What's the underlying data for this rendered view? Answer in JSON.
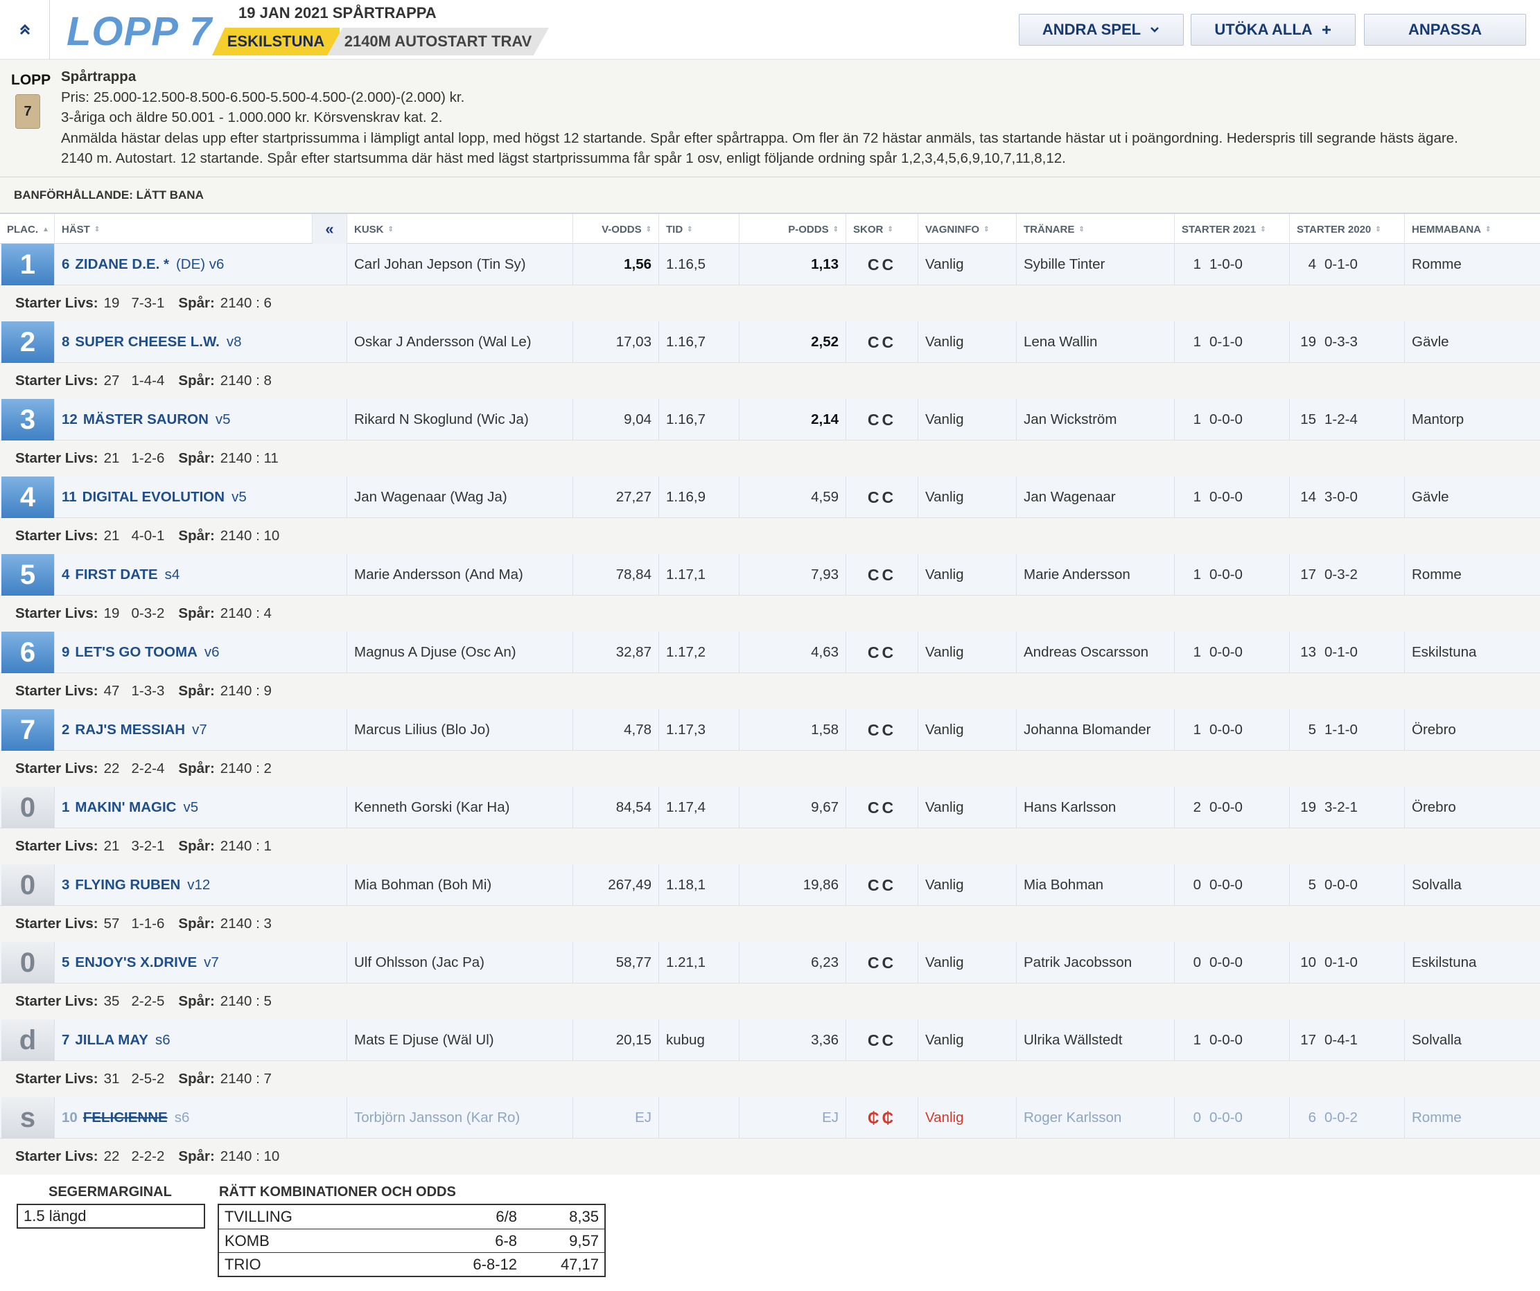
{
  "header": {
    "race_title": "LOPP 7",
    "date_line": "19 JAN 2021 SPÅRTRAPPA",
    "track": "ESKILSTUNA",
    "distance": "2140M AUTOSTART TRAV",
    "collapse_icon": "double-chevron-up",
    "buttons": {
      "andra_spel": "ANDRA SPEL",
      "andra_spel_icon": "chevron-down",
      "utoka_alla": "UTÖKA ALLA",
      "utoka_alla_icon": "plus",
      "anpassa": "ANPASSA"
    }
  },
  "info": {
    "lopp_label": "LOPP",
    "lopp_number": "7",
    "lines": [
      "Spårtrappa",
      "Pris: 25.000-12.500-8.500-6.500-5.500-4.500-(2.000)-(2.000) kr.",
      "3-åriga och äldre 50.001 - 1.000.000 kr. Körsvenskrav kat. 2.",
      "Anmälda hästar delas upp efter startprissumma i lämpligt antal lopp, med högst 12 startande. Spår efter spårtrappa. Om fler än 72 hästar anmäls, tas startande hästar ut i poängordning. Hederspris till segrande hästs ägare.",
      "2140 m. Autostart. 12 startande. Spår efter startsumma där häst med lägst startprissumma får spår 1 osv, enligt följande ordning spår 1,2,3,4,5,6,9,10,7,11,8,12."
    ]
  },
  "condition": "BANFÖRHÅLLANDE: LÄTT BANA",
  "columns": {
    "plac": "PLAC.",
    "hast": "HÄST",
    "collapse": "«",
    "kusk": "KUSK",
    "vodds": "V-ODDS",
    "tid": "TID",
    "podds": "P-ODDS",
    "skor": "SKOR",
    "vagninfo": "VAGNINFO",
    "tranare": "TRÄNARE",
    "starter2021": "STARTER 2021",
    "starter2020": "STARTER 2020",
    "hemmabana": "HEMMABANA"
  },
  "sub_labels": {
    "starter_livs": "Starter Livs:",
    "spar": "Spår:"
  },
  "rows": [
    {
      "plac": "1",
      "nr": "6",
      "name": "ZIDANE D.E. *",
      "extra": "(DE)  v6",
      "kusk": "Carl Johan Jepson (Tin Sy)",
      "vodds": "1,56",
      "tid": "1.16,5",
      "podds": "1,13",
      "skor": "CC",
      "vagn": "Vanlig",
      "tranare": "Sybille Tinter",
      "s21n": "1",
      "s21": "1-0-0",
      "s20n": "4",
      "s20": "0-1-0",
      "hem": "Romme",
      "livs": "19   7-3-1",
      "spar": "2140 : 6"
    },
    {
      "plac": "2",
      "nr": "8",
      "name": "SUPER CHEESE L.W.",
      "extra": "v8",
      "kusk": "Oskar J Andersson (Wal Le)",
      "vodds": "17,03",
      "tid": "1.16,7",
      "podds": "2,52",
      "skor": "CC",
      "vagn": "Vanlig",
      "tranare": "Lena Wallin",
      "s21n": "1",
      "s21": "0-1-0",
      "s20n": "19",
      "s20": "0-3-3",
      "hem": "Gävle",
      "livs": "27   1-4-4",
      "spar": "2140 : 8"
    },
    {
      "plac": "3",
      "nr": "12",
      "name": "MÄSTER SAURON",
      "extra": "v5",
      "kusk": "Rikard N Skoglund (Wic Ja)",
      "vodds": "9,04",
      "tid": "1.16,7",
      "podds": "2,14",
      "skor": "CC",
      "vagn": "Vanlig",
      "tranare": "Jan Wickström",
      "s21n": "1",
      "s21": "0-0-0",
      "s20n": "15",
      "s20": "1-2-4",
      "hem": "Mantorp",
      "livs": "21   1-2-6",
      "spar": "2140 : 11"
    },
    {
      "plac": "4",
      "nr": "11",
      "name": "DIGITAL EVOLUTION",
      "extra": "v5",
      "kusk": "Jan Wagenaar (Wag Ja)",
      "vodds": "27,27",
      "tid": "1.16,9",
      "podds": "4,59",
      "skor": "CC",
      "vagn": "Vanlig",
      "tranare": "Jan Wagenaar",
      "s21n": "1",
      "s21": "0-0-0",
      "s20n": "14",
      "s20": "3-0-0",
      "hem": "Gävle",
      "livs": "21   4-0-1",
      "spar": "2140 : 10"
    },
    {
      "plac": "5",
      "nr": "4",
      "name": "FIRST DATE",
      "extra": "s4",
      "kusk": "Marie Andersson (And Ma)",
      "vodds": "78,84",
      "tid": "1.17,1",
      "podds": "7,93",
      "skor": "CC",
      "vagn": "Vanlig",
      "tranare": "Marie Andersson",
      "s21n": "1",
      "s21": "0-0-0",
      "s20n": "17",
      "s20": "0-3-2",
      "hem": "Romme",
      "livs": "19   0-3-2",
      "spar": "2140 : 4"
    },
    {
      "plac": "6",
      "nr": "9",
      "name": "LET'S GO TOOMA",
      "extra": "v6",
      "kusk": "Magnus A Djuse (Osc An)",
      "vodds": "32,87",
      "tid": "1.17,2",
      "podds": "4,63",
      "skor": "CC",
      "vagn": "Vanlig",
      "tranare": "Andreas Oscarsson",
      "s21n": "1",
      "s21": "0-0-0",
      "s20n": "13",
      "s20": "0-1-0",
      "hem": "Eskilstuna",
      "livs": "47   1-3-3",
      "spar": "2140 : 9"
    },
    {
      "plac": "7",
      "nr": "2",
      "name": "RAJ'S MESSIAH",
      "extra": "v7",
      "kusk": "Marcus Lilius (Blo Jo)",
      "vodds": "4,78",
      "tid": "1.17,3",
      "podds": "1,58",
      "skor": "CC",
      "vagn": "Vanlig",
      "tranare": "Johanna Blomander",
      "s21n": "1",
      "s21": "0-0-0",
      "s20n": "5",
      "s20": "1-1-0",
      "hem": "Örebro",
      "livs": "22   2-2-4",
      "spar": "2140 : 2"
    },
    {
      "plac": "0",
      "nr": "1",
      "name": "MAKIN' MAGIC",
      "extra": "v5",
      "kusk": "Kenneth Gorski (Kar Ha)",
      "vodds": "84,54",
      "tid": "1.17,4",
      "podds": "9,67",
      "skor": "CC",
      "vagn": "Vanlig",
      "tranare": "Hans Karlsson",
      "s21n": "2",
      "s21": "0-0-0",
      "s20n": "19",
      "s20": "3-2-1",
      "hem": "Örebro",
      "livs": "21   3-2-1",
      "spar": "2140 : 1"
    },
    {
      "plac": "0",
      "nr": "3",
      "name": "FLYING RUBEN",
      "extra": "v12",
      "kusk": "Mia Bohman (Boh Mi)",
      "vodds": "267,49",
      "tid": "1.18,1",
      "podds": "19,86",
      "skor": "CC",
      "vagn": "Vanlig",
      "tranare": "Mia Bohman",
      "s21n": "0",
      "s21": "0-0-0",
      "s20n": "5",
      "s20": "0-0-0",
      "hem": "Solvalla",
      "livs": "57   1-1-6",
      "spar": "2140 : 3"
    },
    {
      "plac": "0",
      "nr": "5",
      "name": "ENJOY'S X.DRIVE",
      "extra": "v7",
      "kusk": "Ulf Ohlsson (Jac Pa)",
      "vodds": "58,77",
      "tid": "1.21,1",
      "podds": "6,23",
      "skor": "CC",
      "vagn": "Vanlig",
      "tranare": "Patrik Jacobsson",
      "s21n": "0",
      "s21": "0-0-0",
      "s20n": "10",
      "s20": "0-1-0",
      "hem": "Eskilstuna",
      "livs": "35   2-2-5",
      "spar": "2140 : 5"
    },
    {
      "plac": "d",
      "nr": "7",
      "name": "JILLA MAY",
      "extra": "s6",
      "kusk": "Mats E Djuse (Wäl Ul)",
      "vodds": "20,15",
      "tid": "kubug",
      "podds": "3,36",
      "skor": "CC",
      "vagn": "Vanlig",
      "tranare": "Ulrika Wällstedt",
      "s21n": "1",
      "s21": "0-0-0",
      "s20n": "17",
      "s20": "0-4-1",
      "hem": "Solvalla",
      "livs": "31   2-5-2",
      "spar": "2140 : 7"
    },
    {
      "plac": "s",
      "nr": "10",
      "name": "FELICIENNE",
      "extra": "s6",
      "kusk": "Torbjörn Jansson (Kar Ro)",
      "vodds": "EJ",
      "tid": "",
      "podds": "EJ",
      "skor": "₵₵",
      "vagn": "Vanlig",
      "tranare": "Roger Karlsson",
      "s21n": "0",
      "s21": "0-0-0",
      "s20n": "6",
      "s20": "0-0-2",
      "hem": "Romme",
      "livs": "22   2-2-2",
      "spar": "2140 : 10"
    }
  ],
  "bottom": {
    "segermarginal_label": "SEGERMARGINAL",
    "segermarginal_value": "1.5 längd",
    "odds_label": "RÄTT KOMBINATIONER OCH ODDS",
    "odds": [
      {
        "type": "TVILLING",
        "combo": "6/8",
        "odds": "8,35"
      },
      {
        "type": "KOMB",
        "combo": "6-8",
        "odds": "9,57"
      },
      {
        "type": "TRIO",
        "combo": "6-8-12",
        "odds": "47,17"
      }
    ]
  },
  "colors": {
    "accent": "#1f4e8d",
    "plac_blue": "#4f8ccc",
    "track_tag": "#f5cf2c",
    "scratched_red": "#d23b2d"
  }
}
